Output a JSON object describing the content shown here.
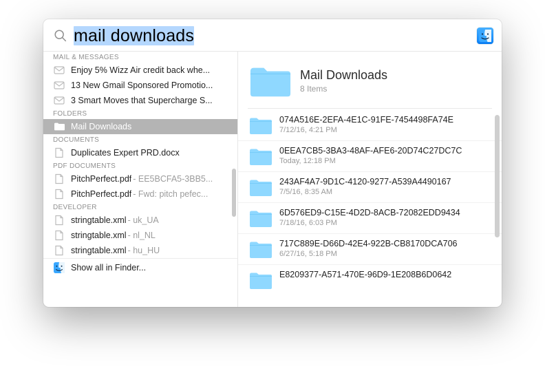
{
  "search": {
    "query": "mail downloads"
  },
  "sidebar": {
    "sections": [
      {
        "header": "MAIL & MESSAGES",
        "items": [
          {
            "icon": "mail-icon",
            "label": "Enjoy 5% Wizz Air credit back whe..."
          },
          {
            "icon": "mail-icon",
            "label": "13 New Gmail Sponsored Promotio..."
          },
          {
            "icon": "mail-icon",
            "label": "3 Smart Moves that Supercharge S..."
          }
        ]
      },
      {
        "header": "FOLDERS",
        "items": [
          {
            "icon": "folder-icon",
            "label": "Mail Downloads",
            "selected": true
          }
        ]
      },
      {
        "header": "DOCUMENTS",
        "items": [
          {
            "icon": "doc-icon",
            "label": "Duplicates Expert PRD.docx"
          }
        ]
      },
      {
        "header": "PDF DOCUMENTS",
        "items": [
          {
            "icon": "pdf-icon",
            "label": "PitchPerfect.pdf",
            "suffix": "  - EE5BCFA5-3BB5..."
          },
          {
            "icon": "pdf-icon",
            "label": "PitchPerfect.pdf",
            "suffix": "  - Fwd: pitch pefec..."
          }
        ]
      },
      {
        "header": "DEVELOPER",
        "items": [
          {
            "icon": "doc-icon",
            "label": "stringtable.xml",
            "suffix": "  - uk_UA"
          },
          {
            "icon": "doc-icon",
            "label": "stringtable.xml",
            "suffix": "  - nl_NL"
          },
          {
            "icon": "doc-icon",
            "label": "stringtable.xml",
            "suffix": "  - hu_HU"
          }
        ]
      }
    ],
    "showAll": "Show all in Finder..."
  },
  "detail": {
    "title": "Mail Downloads",
    "subtitle": "8 Items",
    "items": [
      {
        "name": "074A516E-2EFA-4E1C-91FE-7454498FA74E",
        "date": "7/12/16, 4:21 PM"
      },
      {
        "name": "0EEA7CB5-3BA3-48AF-AFE6-20D74C27DC7C",
        "date": "Today, 12:18 PM"
      },
      {
        "name": "243AF4A7-9D1C-4120-9277-A539A4490167",
        "date": "7/5/16, 8:35 AM"
      },
      {
        "name": "6D576ED9-C15E-4D2D-8ACB-72082EDD9434",
        "date": "7/18/16, 6:03 PM"
      },
      {
        "name": "717C889E-D66D-42E4-922B-CB8170DCA706",
        "date": "6/27/16, 5:18 PM"
      },
      {
        "name": "E8209377-A571-470E-96D9-1E208B6D0642",
        "date": ""
      }
    ]
  }
}
